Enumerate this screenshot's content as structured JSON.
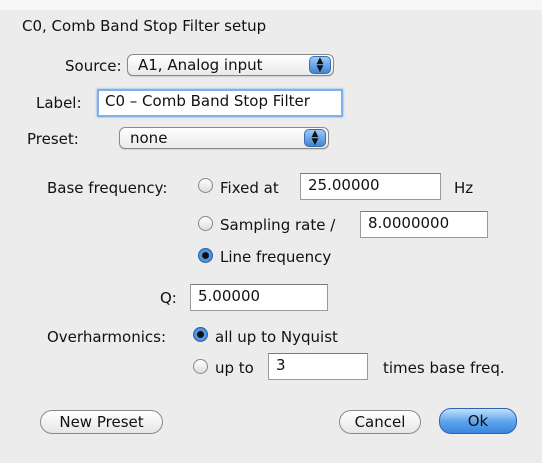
{
  "dialog": {
    "title": "C0, Comb Band Stop Filter setup"
  },
  "source": {
    "label": "Source:",
    "value": "A1, Analog input"
  },
  "name_label": {
    "label": "Label:",
    "value": "C0 – Comb Band Stop Filter"
  },
  "preset": {
    "label": "Preset:",
    "value": "none"
  },
  "base_frequency": {
    "label": "Base frequency:",
    "selected": "line_frequency",
    "fixed": {
      "label": "Fixed at",
      "value": "25.00000",
      "unit": "Hz"
    },
    "sampling": {
      "label": "Sampling rate /",
      "value": "8.0000000"
    },
    "line": {
      "label": "Line frequency"
    }
  },
  "q": {
    "label": "Q:",
    "value": "5.00000"
  },
  "overharmonics": {
    "label": "Overharmonics:",
    "selected": "all",
    "all": {
      "label": "all up to Nyquist"
    },
    "upto": {
      "label": "up to",
      "value": "3",
      "suffix": "times base freq."
    }
  },
  "buttons": {
    "new_preset": "New Preset",
    "cancel": "Cancel",
    "ok": "Ok"
  },
  "colors": {
    "accent": "#3b86dc",
    "focus_ring": "#7fb0e8",
    "window_bg": "#ececec"
  }
}
